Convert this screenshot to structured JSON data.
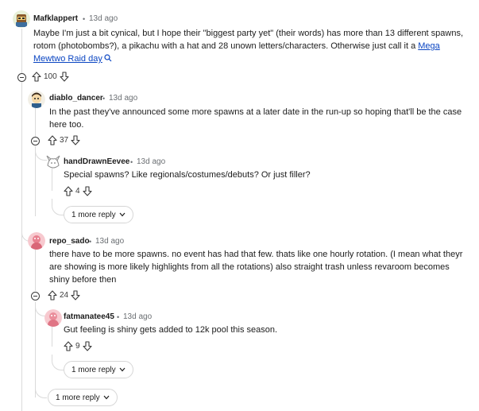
{
  "comments": [
    {
      "author": "Mafklappert",
      "time": "13d ago",
      "body_lines": [
        "Maybe I'm just a bit cynical, but I hope their \"biggest party yet\" (their words) has more than 13 different spawns,",
        "rotom (photobombs?), a pikachu with a hat and 28 unown letters/characters. Otherwise just call it a"
      ],
      "link_part1": "Mega",
      "link_part2": "Mewtwo Raid day",
      "votes": "100"
    },
    {
      "author": "diablo_dancer",
      "time": "13d ago",
      "body_lines": [
        "In the past they've announced some more spawns at a later date in the run-up so hoping that'll be the case",
        "here too."
      ],
      "votes": "37"
    },
    {
      "author": "handDrawnEevee",
      "time": "13d ago",
      "body_lines": [
        "Special spawns? Like regionals/costumes/debuts? Or just filler?"
      ],
      "votes": "4"
    },
    {
      "author": "repo_sado",
      "time": "13d ago",
      "body_lines": [
        "there have to be more spawns. no event has had that few. thats like one hourly rotation. (I mean what theyr",
        "are showing is more likely highlights from all the rotations) also straight trash unless revaroom becomes",
        "shiny before then"
      ],
      "votes": "24"
    },
    {
      "author": "fatmanatee45",
      "time": "13d ago",
      "body_lines": [
        "Gut feeling is shiny gets added to 12k pool this season."
      ],
      "votes": "9"
    }
  ],
  "more_replies": [
    "1 more reply",
    "1 more reply",
    "1 more reply"
  ],
  "separator": "•",
  "icons": [
    "upvote-icon",
    "downvote-icon",
    "search-icon",
    "chevron-down-icon",
    "collapse-icon"
  ],
  "colors": {
    "link": "#0a45c2",
    "meta": "#6b6f73",
    "thread_line": "#dadada"
  }
}
